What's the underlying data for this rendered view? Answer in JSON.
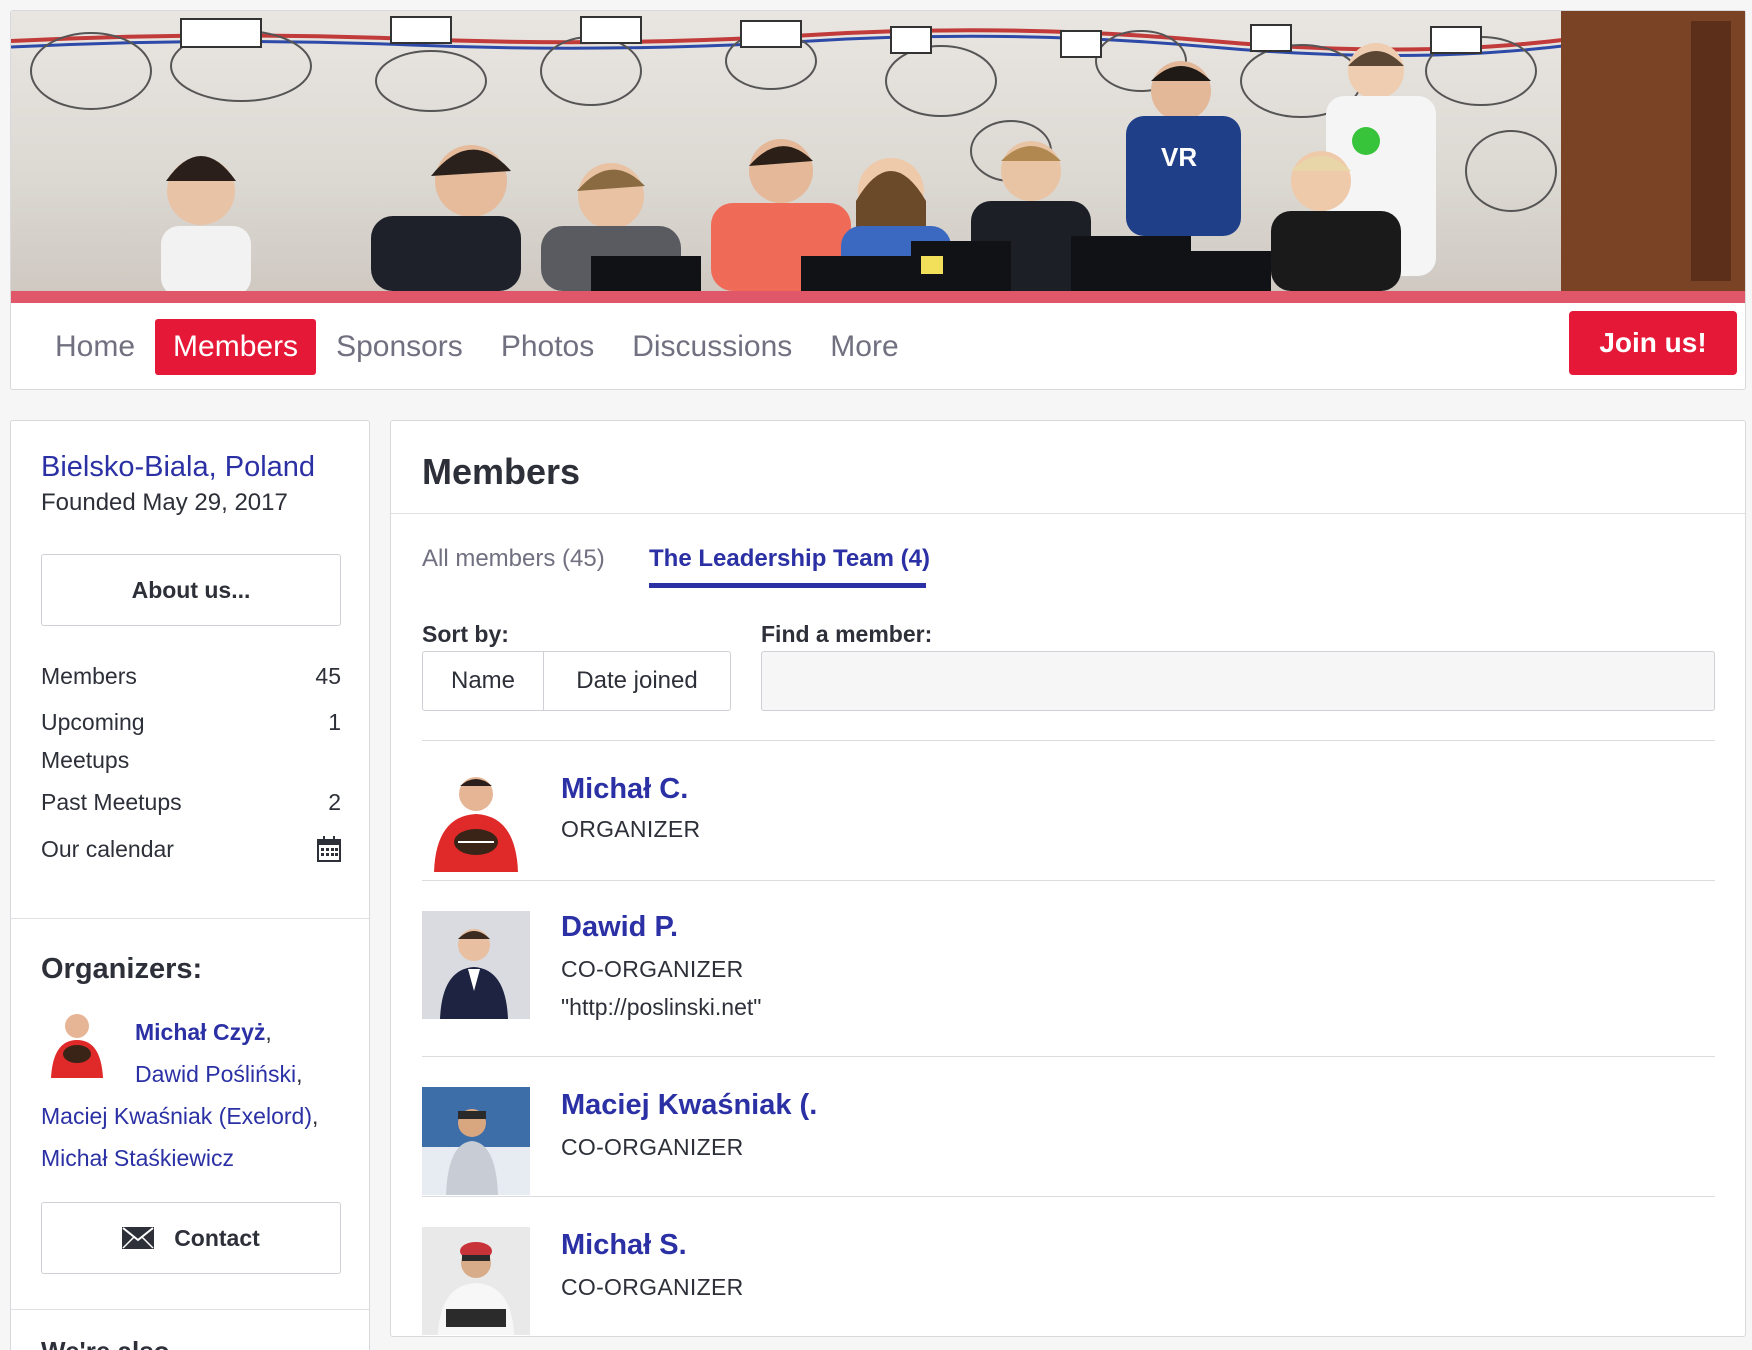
{
  "nav": {
    "items": [
      {
        "label": "Home",
        "active": false
      },
      {
        "label": "Members",
        "active": true
      },
      {
        "label": "Sponsors",
        "active": false
      },
      {
        "label": "Photos",
        "active": false
      },
      {
        "label": "Discussions",
        "active": false
      },
      {
        "label": "More",
        "active": false
      }
    ],
    "join_label": "Join us!"
  },
  "sidebar": {
    "location": "Bielsko-Biala, Poland",
    "founded": "Founded May 29, 2017",
    "about_label": "About us...",
    "stats": {
      "members_label": "Members",
      "members_value": "45",
      "upcoming_label": "Upcoming Meetups",
      "upcoming_value": "1",
      "past_label": "Past Meetups",
      "past_value": "2",
      "calendar_label": "Our calendar"
    },
    "organizers_title": "Organizers:",
    "organizers": [
      "Michał Czyż",
      "Dawid Pośliński",
      "Maciej Kwaśniak (Exelord)",
      "Michał Staśkiewicz"
    ],
    "contact_label": "Contact",
    "next_section_title": "We're also..."
  },
  "main": {
    "title": "Members",
    "tabs": {
      "all": "All members (45)",
      "leadership": "The Leadership Team (4)"
    },
    "sort_label": "Sort by:",
    "sort_options": {
      "name": "Name",
      "date": "Date joined"
    },
    "find_label": "Find a member:",
    "search_value": "",
    "members": [
      {
        "name": "Michał C.",
        "role": "ORGANIZER",
        "extra": ""
      },
      {
        "name": "Dawid P.",
        "role": "CO-ORGANIZER",
        "extra": "\"http://poslinski.net\""
      },
      {
        "name": "Maciej Kwaśniak (.",
        "role": "CO-ORGANIZER",
        "extra": ""
      },
      {
        "name": "Michał S.",
        "role": "CO-ORGANIZER",
        "extra": ""
      }
    ]
  },
  "colors": {
    "accent": "#e51937",
    "link": "#2b31a5",
    "banner_stripe": "#e0576a"
  },
  "icons": [
    "calendar-icon",
    "envelope-icon"
  ]
}
